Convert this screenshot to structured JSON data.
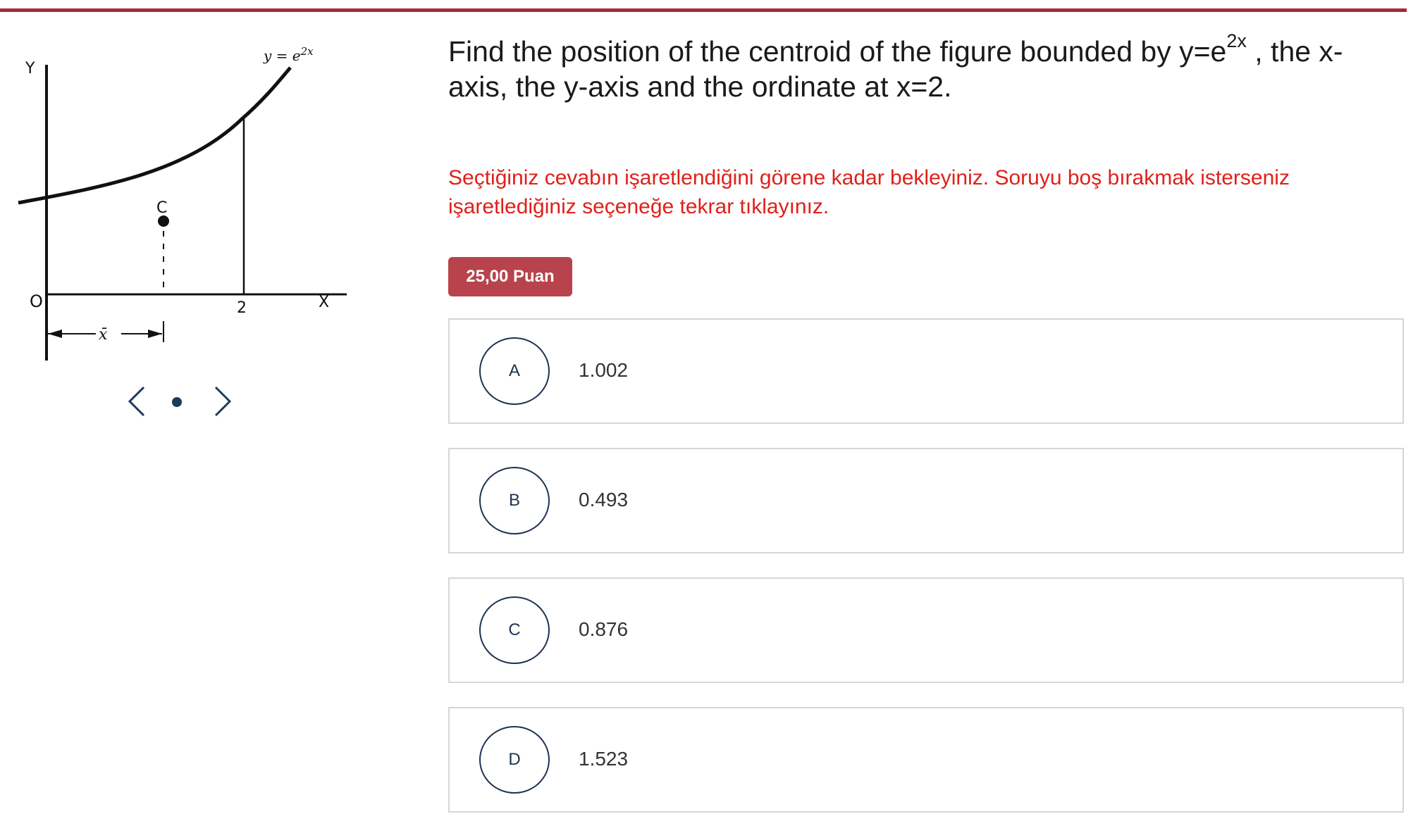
{
  "figure": {
    "y_axis_label": "Y",
    "x_axis_label": "X",
    "origin_label": "O",
    "curve_label_base": "y = e",
    "curve_label_exp": "2x",
    "centroid_label": "C",
    "tick_label_2": "2",
    "xbar_label": "x̄"
  },
  "carousel": {
    "prev_icon": "chevron-left-icon",
    "next_icon": "chevron-right-icon",
    "dot_color": "#1e3a5a"
  },
  "question": {
    "text_before": "Find the position of the centroid of the figure bounded by y=e",
    "superscript": "2x",
    "text_after": " , the x-axis, the y-axis and the ordinate at x=2."
  },
  "notice": "Seçtiğiniz cevabın işaretlendiğini görene kadar bekleyiniz. Soruyu boş bırakmak isterseniz işaretlediğiniz seçeneğe tekrar tıklayınız.",
  "points_badge": "25,00 Puan",
  "options": [
    {
      "letter": "A",
      "value": "1.002"
    },
    {
      "letter": "B",
      "value": "0.493"
    },
    {
      "letter": "C",
      "value": "0.876"
    },
    {
      "letter": "D",
      "value": "1.523"
    }
  ],
  "colors": {
    "accent_rule": "#a52a3c",
    "badge": "#b8434c",
    "notice_text": "#e0201a",
    "circle_border": "#1f3350"
  }
}
